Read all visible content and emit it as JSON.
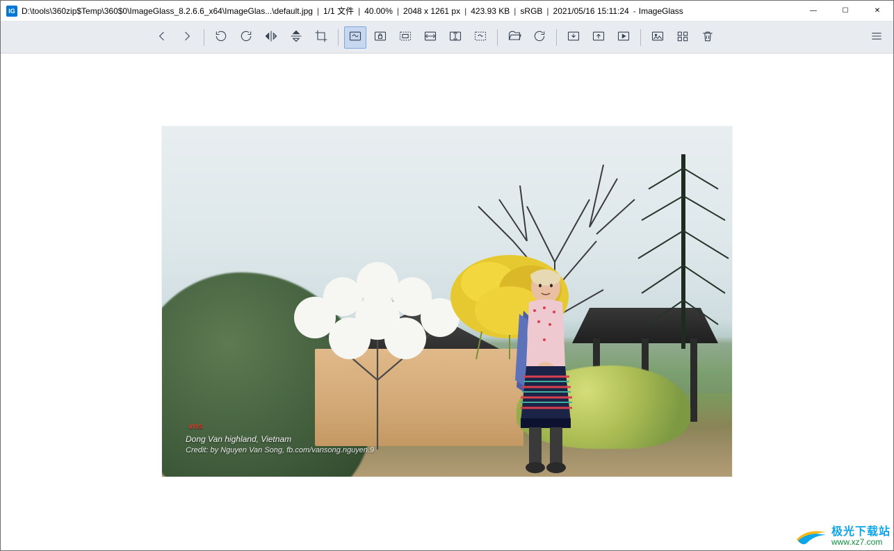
{
  "titlebar": {
    "app_icon_text": "IG",
    "path": "D:\\tools\\360zip$Temp\\360$0\\ImageGlass_8.2.6.6_x64\\ImageGlas...\\default.jpg",
    "file_index": "1/1 文件",
    "zoom": "40.00%",
    "dimensions": "2048 x 1261 px",
    "filesize": "423.93 KB",
    "color_profile": "sRGB",
    "timestamp": "2021/05/16 15:11:24",
    "app_name": "ImageGlass",
    "separator": "|",
    "dash": "-",
    "min_glyph": "—",
    "max_glyph": "☐",
    "close_glyph": "✕"
  },
  "toolbar": {
    "icons": [
      "prev-icon",
      "next-icon",
      "divider",
      "rotate-ccw-icon",
      "rotate-cw-icon",
      "flip-horizontal-icon",
      "flip-vertical-icon",
      "crop-icon",
      "divider",
      "fit-window-icon",
      "lock-zoom-icon",
      "actual-size-icon",
      "fit-width-icon",
      "fit-height-icon",
      "auto-zoom-icon",
      "divider",
      "open-file-icon",
      "refresh-icon",
      "divider",
      "save-icon",
      "export-icon",
      "slideshow-icon",
      "divider",
      "fullscreen-icon",
      "thumbnails-icon",
      "delete-icon"
    ],
    "active_icon": "fit-window-icon",
    "menu_icon": "menu-icon"
  },
  "image": {
    "caption_line1": "Dong Van highland, Vietnam",
    "caption_line2": "Credit: by Nguyen Van Song, fb.com/vansong.nguyen.9",
    "vlogo": "vns"
  },
  "watermark": {
    "cn": "极光下载站",
    "url": "www.xz7.com"
  }
}
